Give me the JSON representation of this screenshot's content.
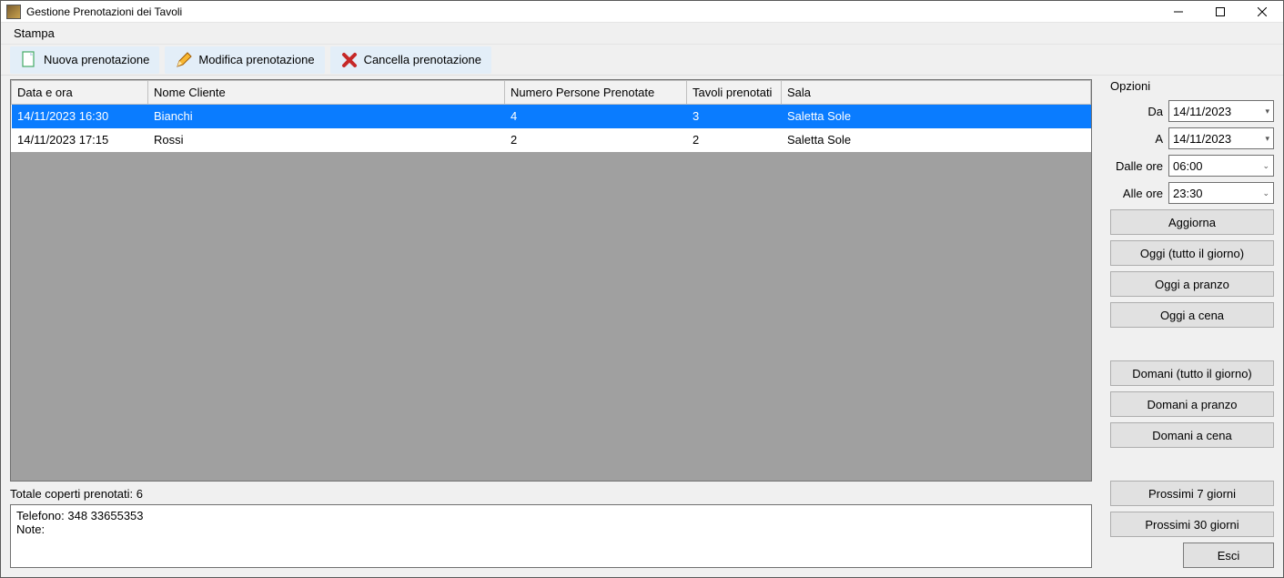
{
  "window": {
    "title": "Gestione Prenotazioni dei Tavoli"
  },
  "menubar": {
    "print": "Stampa"
  },
  "toolbar": {
    "new_label": "Nuova prenotazione",
    "edit_label": "Modifica prenotazione",
    "delete_label": "Cancella prenotazione"
  },
  "grid": {
    "columns": {
      "datetime": "Data e ora",
      "client": "Nome Cliente",
      "people": "Numero Persone Prenotate",
      "tables": "Tavoli prenotati",
      "room": "Sala"
    },
    "rows": [
      {
        "datetime": "14/11/2023 16:30",
        "client": "Bianchi",
        "people": "4",
        "tables": "3",
        "room": "Saletta Sole",
        "selected": true
      },
      {
        "datetime": "14/11/2023 17:15",
        "client": "Rossi",
        "people": "2",
        "tables": "2",
        "room": "Saletta Sole",
        "selected": false
      }
    ]
  },
  "summary": {
    "total_covers": "Totale coperti prenotati: 6"
  },
  "detail": {
    "phone_line": "Telefono: 348 33655353",
    "notes_line": "Note:"
  },
  "options": {
    "header": "Opzioni",
    "from_label": "Da",
    "from_value": "14/11/2023",
    "to_label": "A",
    "to_value": "14/11/2023",
    "from_time_label": "Dalle ore",
    "from_time_value": "06:00",
    "to_time_label": "Alle ore",
    "to_time_value": "23:30",
    "refresh": "Aggiorna",
    "today_all": "Oggi (tutto il giorno)",
    "today_lunch": "Oggi a pranzo",
    "today_dinner": "Oggi a cena",
    "tomorrow_all": "Domani (tutto il giorno)",
    "tomorrow_lunch": "Domani a pranzo",
    "tomorrow_dinner": "Domani a cena",
    "next7": "Prossimi 7 giorni",
    "next30": "Prossimi 30 giorni",
    "exit": "Esci"
  }
}
